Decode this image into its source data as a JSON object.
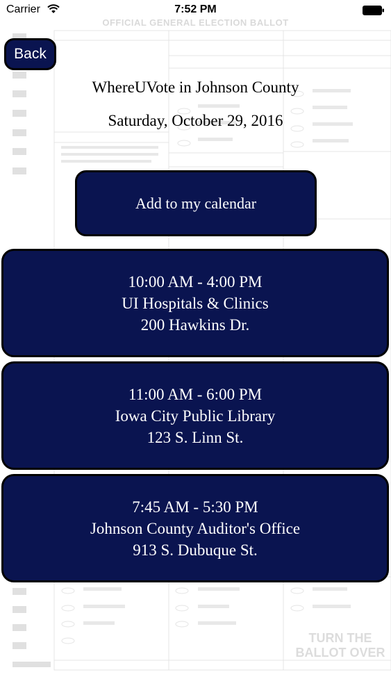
{
  "status_bar": {
    "carrier": "Carrier",
    "time": "7:52 PM"
  },
  "background": {
    "ballot_header": "OFFICIAL GENERAL ELECTION BALLOT",
    "ballot_footer": "TURN THE BALLOT OVER"
  },
  "nav": {
    "back_label": "Back"
  },
  "header": {
    "title": "WhereUVote in Johnson County",
    "date": "Saturday, October 29, 2016"
  },
  "actions": {
    "calendar_label": "Add to my calendar"
  },
  "locations": [
    {
      "hours": "10:00 AM - 4:00 PM",
      "name": "UI Hospitals & Clinics",
      "address": "200 Hawkins Dr."
    },
    {
      "hours": "11:00 AM - 6:00 PM",
      "name": "Iowa City Public Library",
      "address": "123 S. Linn St."
    },
    {
      "hours": "7:45 AM - 5:30 PM",
      "name": "Johnson County Auditor's Office",
      "address": "913 S. Dubuque St."
    }
  ],
  "colors": {
    "button_fill": "#0a1450",
    "button_border": "#000000",
    "button_text": "#ffffff"
  }
}
